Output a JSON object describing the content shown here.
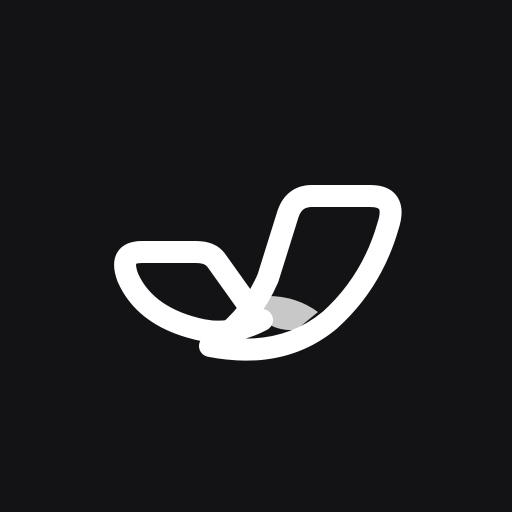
{
  "app_icon": {
    "background_color": "#131315",
    "logo": {
      "icon_name": "checkmark-swoosh-logo-icon",
      "stroke_color": "#ffffff",
      "shadow_color": "#c8c8c8"
    }
  }
}
